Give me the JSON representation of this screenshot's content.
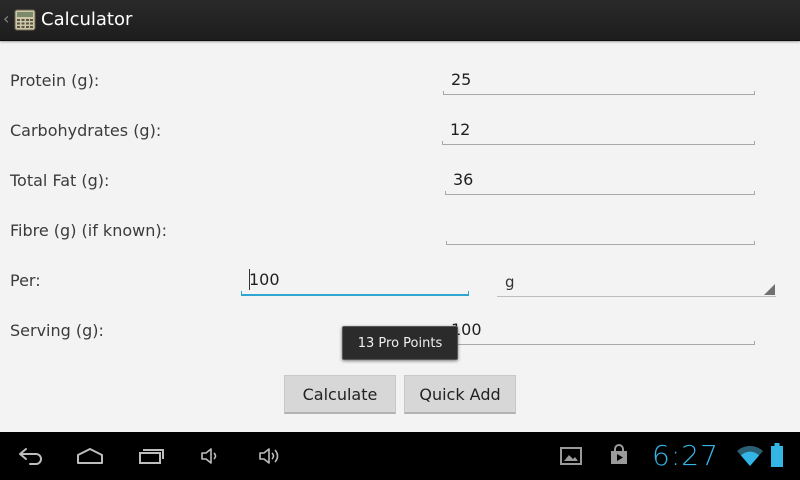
{
  "action_bar": {
    "title": "Calculator",
    "up_icon": "chevron-left-icon",
    "app_icon": "calculator-icon"
  },
  "form": {
    "protein": {
      "label": "Protein (g):",
      "value": "25"
    },
    "carbohydrates": {
      "label": "Carbohydrates (g):",
      "value": "12"
    },
    "total_fat": {
      "label": "Total Fat (g):",
      "value": "36"
    },
    "fibre": {
      "label": "Fibre (g) (if known):",
      "value": ""
    },
    "per": {
      "label": "Per:",
      "value": "100",
      "unit": "g"
    },
    "serving": {
      "label": "Serving (g):",
      "value": "100"
    }
  },
  "toast": {
    "text": "13 Pro Points"
  },
  "buttons": {
    "calculate": "Calculate",
    "quick_add": "Quick Add"
  },
  "system_bar": {
    "clock": "6:27",
    "icons": [
      "back-icon",
      "home-icon",
      "recent-apps-icon",
      "volume-down-icon",
      "volume-up-icon",
      "gallery-icon",
      "store-icon",
      "wifi-icon",
      "battery-icon"
    ]
  },
  "colors": {
    "accent": "#33b5e5",
    "focus_underline": "#2fa6cf",
    "action_bar": "#1d1d1d",
    "background": "#f3f3f3"
  }
}
